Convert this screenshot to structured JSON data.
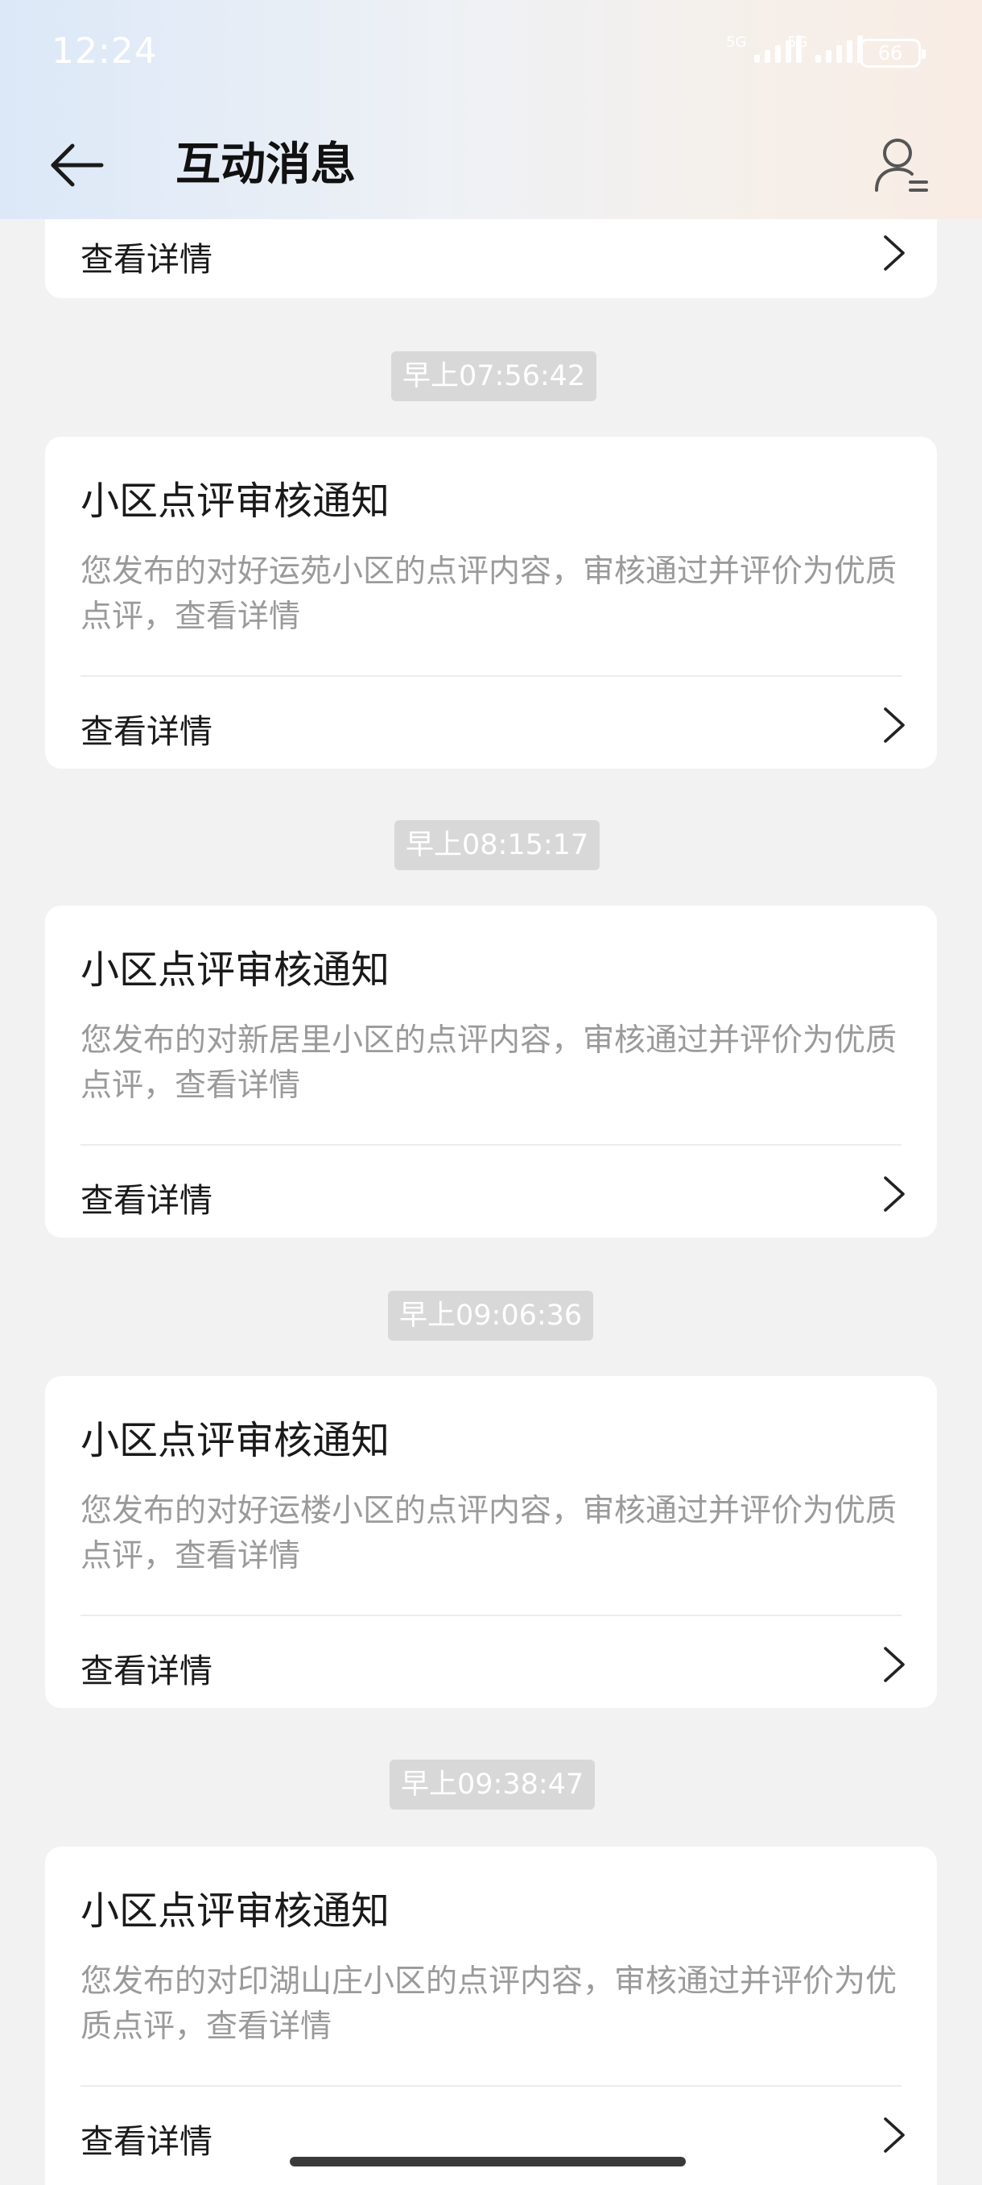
{
  "status_bar": {
    "time": "12:24",
    "network_1": "5G",
    "network_2": "5G",
    "battery": "66"
  },
  "header": {
    "title": "互动消息"
  },
  "detail_label": "查看详情",
  "messages": [
    {
      "time": "早上07:56:42",
      "title": "小区点评审核通知",
      "body": "您发布的对好运苑小区的点评内容，审核通过并评价为优质点评，查看详情"
    },
    {
      "time": "早上08:15:17",
      "title": "小区点评审核通知",
      "body": "您发布的对新居里小区的点评内容，审核通过并评价为优质点评，查看详情"
    },
    {
      "time": "早上09:06:36",
      "title": "小区点评审核通知",
      "body": "您发布的对好运楼小区的点评内容，审核通过并评价为优质点评，查看详情"
    },
    {
      "time": "早上09:38:47",
      "title": "小区点评审核通知",
      "body": "您发布的对印湖山庄小区的点评内容，审核通过并评价为优质点评，查看详情"
    }
  ]
}
